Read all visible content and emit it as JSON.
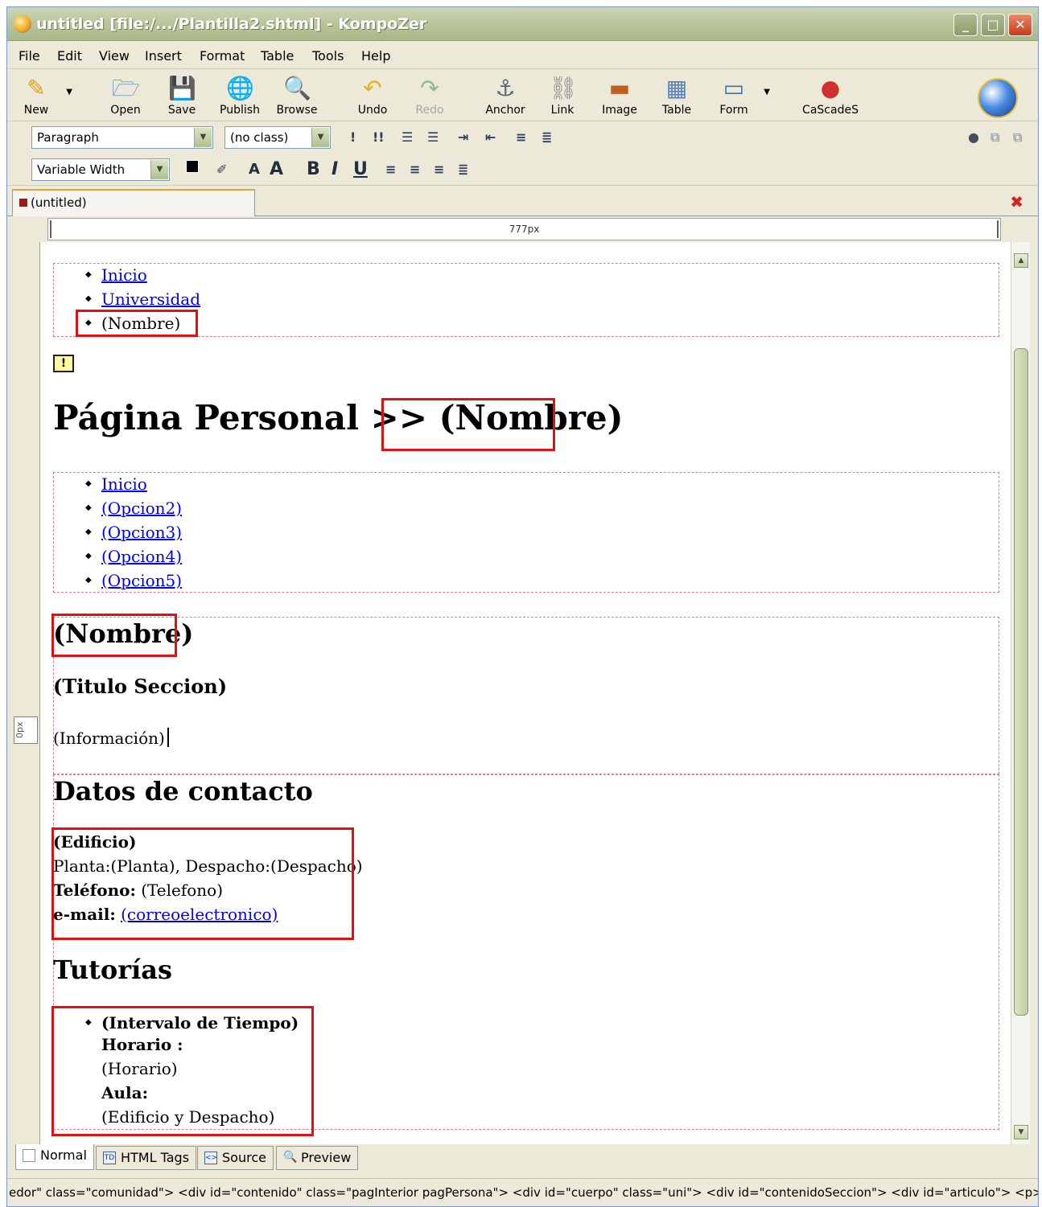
{
  "window": {
    "title": "untitled [file:/.../Plantilla2.shtml] - KompoZer"
  },
  "menu": [
    "File",
    "Edit",
    "View",
    "Insert",
    "Format",
    "Table",
    "Tools",
    "Help"
  ],
  "toolbar": {
    "new": "New",
    "open": "Open",
    "save": "Save",
    "publish": "Publish",
    "browse": "Browse",
    "undo": "Undo",
    "redo": "Redo",
    "anchor": "Anchor",
    "link": "Link",
    "image": "Image",
    "table": "Table",
    "form": "Form",
    "cascades": "CaScadeS"
  },
  "format_bar": {
    "paragraph": "Paragraph",
    "class": "(no class)",
    "font": "Variable Width"
  },
  "tab": {
    "label": "(untitled)"
  },
  "ruler": {
    "width_label": "777px"
  },
  "gutter": {
    "label": "0px"
  },
  "content": {
    "top_nav": [
      "Inicio",
      "Universidad",
      "(Nombre)"
    ],
    "heading_prefix": "Página Personal >> ",
    "heading_name": "(Nombre)",
    "section_nav": [
      "Inicio",
      "(Opcion2)",
      "(Opcion3)",
      "(Opcion4)",
      "(Opcion5)"
    ],
    "name_heading": "(Nombre)",
    "section_title": "(Titulo Seccion)",
    "info": "(Información)",
    "contact_heading": "Datos de contacto",
    "building": "(Edificio)",
    "floor_office": "Planta:(Planta), Despacho:(Despacho)",
    "phone_label": "Teléfono:",
    "phone_value": " (Telefono)",
    "email_label": "e-mail:",
    "email_value": "(correoelectronico)",
    "tutorias_heading": "Tutorías",
    "interval": "(Intervalo de Tiempo)",
    "horario_label": "Horario :",
    "horario_value": "(Horario)",
    "aula_label": "Aula:",
    "aula_value": "(Edificio y Despacho)"
  },
  "view_tabs": [
    "Normal",
    "HTML Tags",
    "Source",
    "Preview"
  ],
  "status": "edor\" class=\"comunidad\">  <div id=\"contenido\" class=\"pagInterior pagPersona\">  <div id=\"cuerpo\" class=\"uni\">  <div id=\"contenidoSeccion\">  <div id=\"articulo\">  <p>"
}
